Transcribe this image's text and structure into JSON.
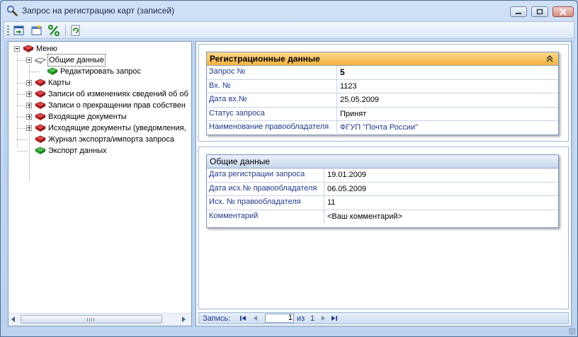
{
  "window": {
    "title": "Запрос на регистрацию карт (записей)"
  },
  "tree": {
    "items": [
      {
        "label": "Меню",
        "level": 0,
        "expander": "minus",
        "icon": "book-red"
      },
      {
        "label": "Общие данные",
        "level": 1,
        "expander": "minus",
        "icon": "book-open"
      },
      {
        "label": "Редактировать запрос",
        "level": 2,
        "expander": "",
        "icon": "book-green"
      },
      {
        "label": "Карты",
        "level": 1,
        "expander": "plus",
        "icon": "book-red"
      },
      {
        "label": "Записи об изменениях сведений об об",
        "level": 1,
        "expander": "plus",
        "icon": "book-red"
      },
      {
        "label": "Записи о прекращении прав собствен",
        "level": 1,
        "expander": "plus",
        "icon": "book-red"
      },
      {
        "label": "Входящие документы",
        "level": 1,
        "expander": "plus",
        "icon": "book-red"
      },
      {
        "label": "Исходящие документы (уведомления,",
        "level": 1,
        "expander": "plus",
        "icon": "book-red"
      },
      {
        "label": "Журнал экспорта/импорта запроса",
        "level": 1,
        "expander": "",
        "icon": "book-red"
      },
      {
        "label": "Экспорт данных",
        "level": 1,
        "expander": "",
        "icon": "book-green"
      }
    ]
  },
  "registration": {
    "header": "Регистрационные данные",
    "rows": [
      {
        "key": "Запрос №",
        "value": "5"
      },
      {
        "key": "Вх. №",
        "value": "1123"
      },
      {
        "key": "Дата вх.№",
        "value": "25.05.2009"
      },
      {
        "key": "Статус запроса",
        "value": "Принят"
      },
      {
        "key": "Наименование правообладателя",
        "value": "ФГУП \"Почта России\""
      }
    ]
  },
  "general": {
    "header": "Общие данные",
    "rows": [
      {
        "key": "Дата регистрации запроса",
        "value": "19.01.2009"
      },
      {
        "key": "Дата исх.№ правообладателя",
        "value": "06.05.2009"
      },
      {
        "key": "Исх. № правообладателя",
        "value": "11"
      },
      {
        "key": "Комментарий",
        "value": "<Ваш комментарий>"
      }
    ]
  },
  "navigator": {
    "label": "Запись:",
    "current": "1",
    "of": "из",
    "total": "1"
  },
  "colors": {
    "accent_header": "#f5b23f",
    "label_blue": "#1f3a8a",
    "border": "#7f9db9"
  }
}
